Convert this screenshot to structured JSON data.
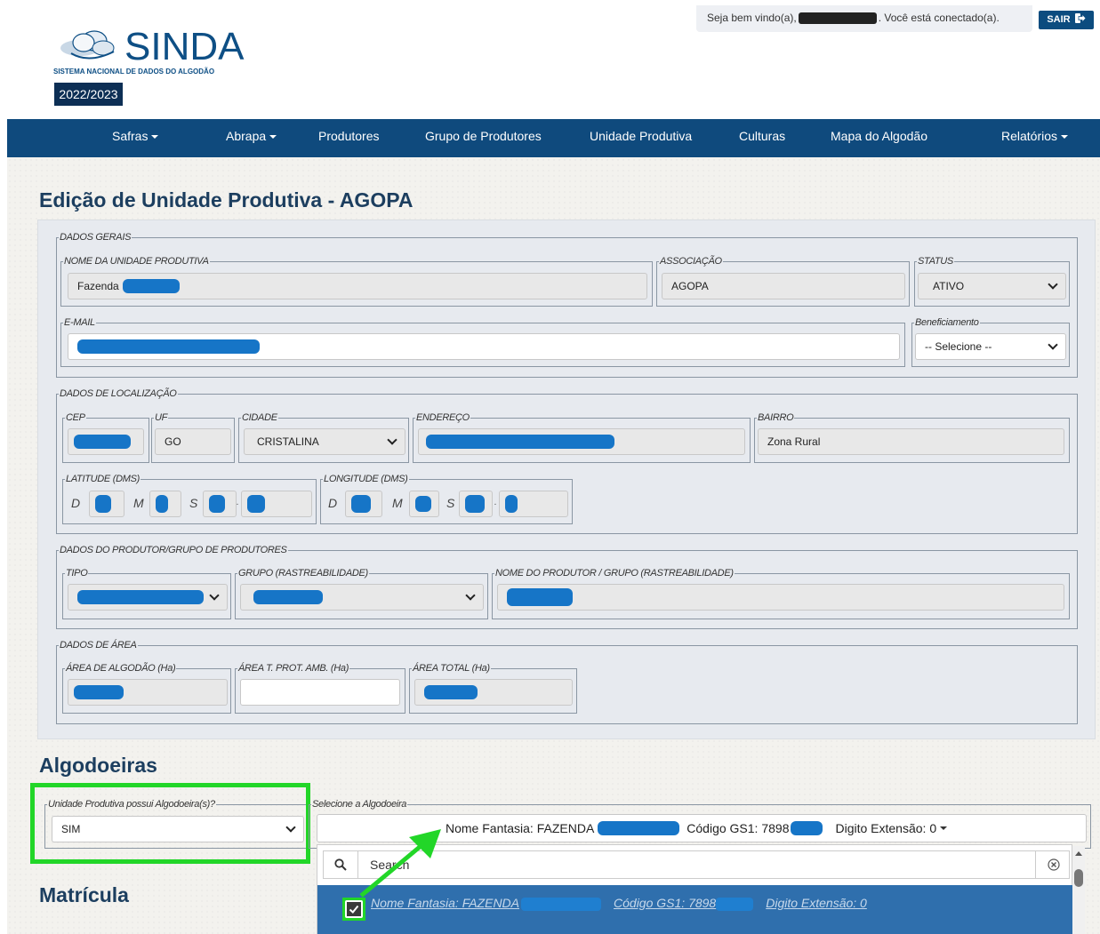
{
  "header": {
    "welcome_prefix": "Seja bem vindo(a),",
    "welcome_suffix": ". Você está conectado(a).",
    "logout_label": "SAIR",
    "logo_text": "SINDA",
    "logo_subtitle": "SISTEMA NACIONAL DE DADOS DO ALGODÃO",
    "year": "2022/2023"
  },
  "nav": {
    "items": [
      {
        "label": "Safras",
        "dropdown": true
      },
      {
        "label": "Abrapa",
        "dropdown": true
      },
      {
        "label": "Produtores",
        "dropdown": false
      },
      {
        "label": "Grupo de Produtores",
        "dropdown": false
      },
      {
        "label": "Unidade Produtiva",
        "dropdown": false
      },
      {
        "label": "Culturas",
        "dropdown": false
      },
      {
        "label": "Mapa do Algodão",
        "dropdown": false
      },
      {
        "label": "Relatórios",
        "dropdown": true
      }
    ]
  },
  "page": {
    "title": "Edição de Unidade Produtiva - AGOPA"
  },
  "dados_gerais": {
    "legend": "DADOS GERAIS",
    "nome_label": "NOME DA UNIDADE PRODUTIVA",
    "nome_value": "Fazenda",
    "associacao_label": "ASSOCIAÇÃO",
    "associacao_value": "AGOPA",
    "status_label": "STATUS",
    "status_value": "ATIVO",
    "email_label": "E-MAIL",
    "beneficiamento_label": "Beneficiamento",
    "beneficiamento_value": "-- Selecione --"
  },
  "localizacao": {
    "legend": "DADOS DE LOCALIZAÇÃO",
    "cep_label": "CEP",
    "uf_label": "UF",
    "uf_value": "GO",
    "cidade_label": "CIDADE",
    "cidade_value": "CRISTALINA",
    "endereco_label": "ENDEREÇO",
    "bairro_label": "BAIRRO",
    "bairro_value": "Zona Rural",
    "latitude_label": "LATITUDE (DMS)",
    "longitude_label": "LONGITUDE (DMS)",
    "d_label": "D",
    "m_label": "M",
    "s_label": "S",
    "dot": "."
  },
  "produtor": {
    "legend": "DADOS DO PRODUTOR/GRUPO DE PRODUTORES",
    "tipo_label": "TIPO",
    "grupo_label": "GRUPO (RASTREABILIDADE)",
    "nome_label": "NOME DO PRODUTOR / GRUPO (RASTREABILIDADE)"
  },
  "area": {
    "legend": "DADOS DE ÁREA",
    "algodao_label": "ÁREA DE ALGODÃO (Ha)",
    "prot_label": "ÁREA T. PROT. AMB. (Ha)",
    "total_label": "ÁREA TOTAL (Ha)"
  },
  "algodoeiras": {
    "heading": "Algodoeiras",
    "possui_label": "Unidade Produtiva possui Algodoeira(s)?",
    "possui_value": "SIM",
    "selecione_label": "Selecione a Algodoeira",
    "selected_nome_prefix": "Nome Fantasia: FAZENDA",
    "selected_codigo_prefix": "Código GS1: 7898",
    "selected_digito": "Digito Extensão: 0",
    "search_placeholder": "Search",
    "option_nome_prefix": "Nome Fantasia: FAZENDA",
    "option_codigo_prefix": "Código GS1: 7898",
    "option_digito": "Digito Extensão: 0"
  },
  "matricula": {
    "heading": "Matrícula"
  },
  "colors": {
    "navbar": "#0f4a7d",
    "title": "#1c3e5f",
    "highlight": "#22d628",
    "redaction": "#1675c7",
    "selected_option": "#2f6fad"
  }
}
